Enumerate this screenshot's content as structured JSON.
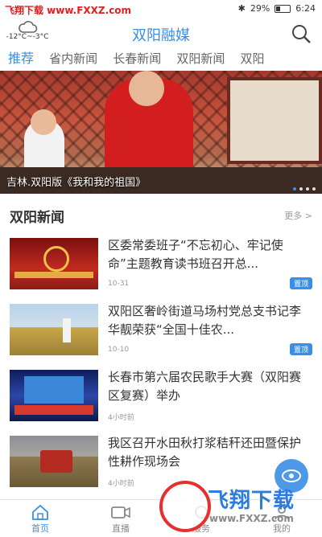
{
  "status_bar": {
    "watermark": "飞翔下载 www.FXXZ.com",
    "battery": "29%",
    "time": "6:24"
  },
  "header": {
    "weather_temp": "-12°C~-3°C",
    "weather_icon": "cloud-icon",
    "title": "双阳融媒",
    "search_icon": "search-icon"
  },
  "tabs": [
    "推荐",
    "省内新闻",
    "长春新闻",
    "双阳新闻",
    "双阳"
  ],
  "banner": {
    "caption": "吉林.双阳版《我和我的祖国》",
    "dots": 4,
    "active_dot": 0
  },
  "section": {
    "title": "双阳新闻",
    "more": "更多 >"
  },
  "news": [
    {
      "title": "区委常委班子“不忘初心、牢记使命”主题教育读书班召开总...",
      "time": "10-31",
      "pin": "置顶"
    },
    {
      "title": "双阳区奢岭街道马场村党总支书记李华靓荣获“全国十佳农...",
      "time": "10-10",
      "pin": "置顶"
    },
    {
      "title": "长春市第六届农民歌手大赛（双阳赛区复赛）举办",
      "time": "4小时前",
      "pin": ""
    },
    {
      "title": "我区召开水田秋打浆秸秆还田暨保护性耕作现场会",
      "time": "4小时前",
      "pin": ""
    }
  ],
  "tabbar": [
    {
      "label": "首页",
      "icon": "home-icon"
    },
    {
      "label": "直播",
      "icon": "video-icon"
    },
    {
      "label": "服务",
      "icon": "service-icon"
    },
    {
      "label": "我的",
      "icon": "user-icon"
    }
  ],
  "watermark": {
    "text": "飞翔下载",
    "url": "www.FXXZ.com"
  },
  "colors": {
    "accent": "#3a8ee6",
    "watermark_red": "#e02020"
  }
}
